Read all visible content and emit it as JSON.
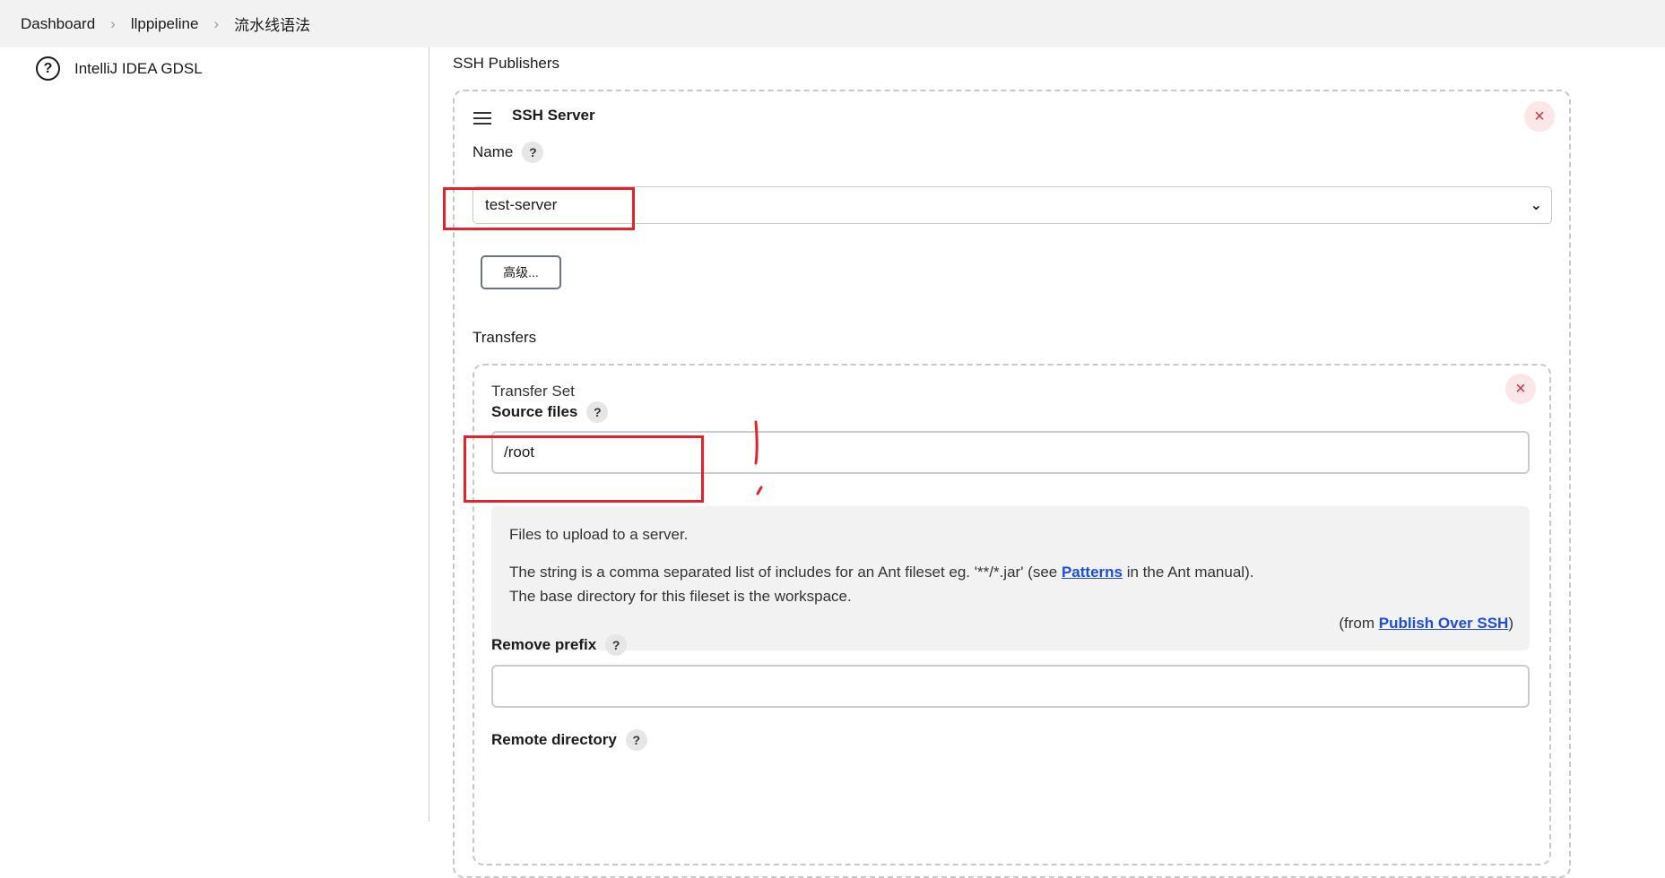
{
  "breadcrumb": [
    "Dashboard",
    "llppipeline",
    "流水线语法"
  ],
  "sidebar": {
    "items": [
      {
        "label": "IntelliJ IDEA GDSL"
      }
    ]
  },
  "main": {
    "section_title": "SSH Publishers",
    "ssh_server": {
      "title": "SSH Server",
      "name_label": "Name",
      "name_value": "test-server",
      "advanced_label": "高级...",
      "transfers_label": "Transfers",
      "transfer_set": {
        "title": "Transfer Set",
        "source_files_label": "Source files",
        "source_files_value": "/root",
        "help": {
          "line1": "Files to upload to a server.",
          "line2_pre": "The string is a comma separated list of includes for an Ant fileset eg. '**/*.jar' (see ",
          "line2_link": "Patterns",
          "line2_post": " in the Ant manual).",
          "line3": "The base directory for this fileset is the workspace.",
          "from_pre": "(from ",
          "from_link": "Publish Over SSH",
          "from_post": ")"
        },
        "remove_prefix_label": "Remove prefix",
        "remove_prefix_value": "",
        "remote_directory_label": "Remote directory"
      }
    }
  },
  "icons": {
    "help": "?",
    "close": "×",
    "chevron": "⌄"
  },
  "colors": {
    "annotation": "#e3222b",
    "link": "#1d4ed8",
    "close": "#d0303a"
  }
}
